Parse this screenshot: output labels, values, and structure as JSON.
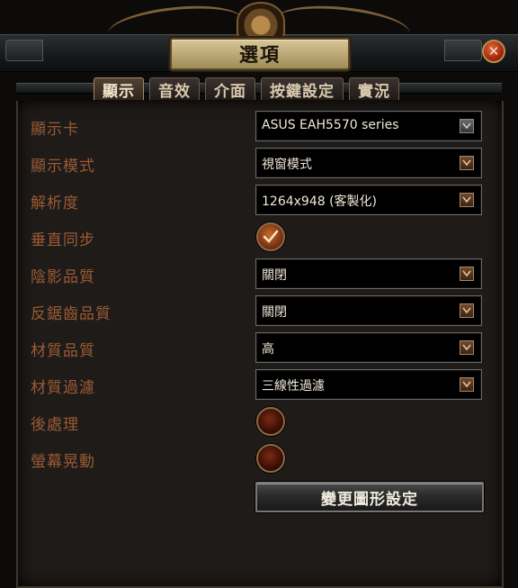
{
  "window": {
    "title": "選項",
    "close_glyph": "✕"
  },
  "tabs": [
    {
      "label": "顯示",
      "active": true
    },
    {
      "label": "音效",
      "active": false
    },
    {
      "label": "介面",
      "active": false
    },
    {
      "label": "按鍵設定",
      "active": false
    },
    {
      "label": "實況",
      "active": false
    }
  ],
  "settings": {
    "graphics_card": {
      "label": "顯示卡",
      "value": "ASUS EAH5570 series"
    },
    "display_mode": {
      "label": "顯示模式",
      "value": "視窗模式"
    },
    "resolution": {
      "label": "解析度",
      "value": "1264x948 (客製化)"
    },
    "vsync": {
      "label": "垂直同步",
      "checked": true
    },
    "shadow_quality": {
      "label": "陰影品質",
      "value": "關閉"
    },
    "antialias_quality": {
      "label": "反鋸齒品質",
      "value": "關閉"
    },
    "texture_quality": {
      "label": "材質品質",
      "value": "高"
    },
    "texture_filter": {
      "label": "材質過濾",
      "value": "三線性過濾"
    },
    "post_processing": {
      "label": "後處理",
      "checked": false
    },
    "screen_shake": {
      "label": "螢幕晃動",
      "checked": false
    }
  },
  "apply_button": {
    "label": "變更圖形設定"
  },
  "colors": {
    "label": "#9a5b36",
    "panel_bg": "#1f1b18",
    "title_plaque": "#c9b784",
    "close_red": "#a12a10"
  },
  "icons": {
    "dropdown": "chevron-down-icon",
    "checkmark": "checkmark-icon",
    "close": "close-icon",
    "gear": "gear-ornament-icon"
  }
}
